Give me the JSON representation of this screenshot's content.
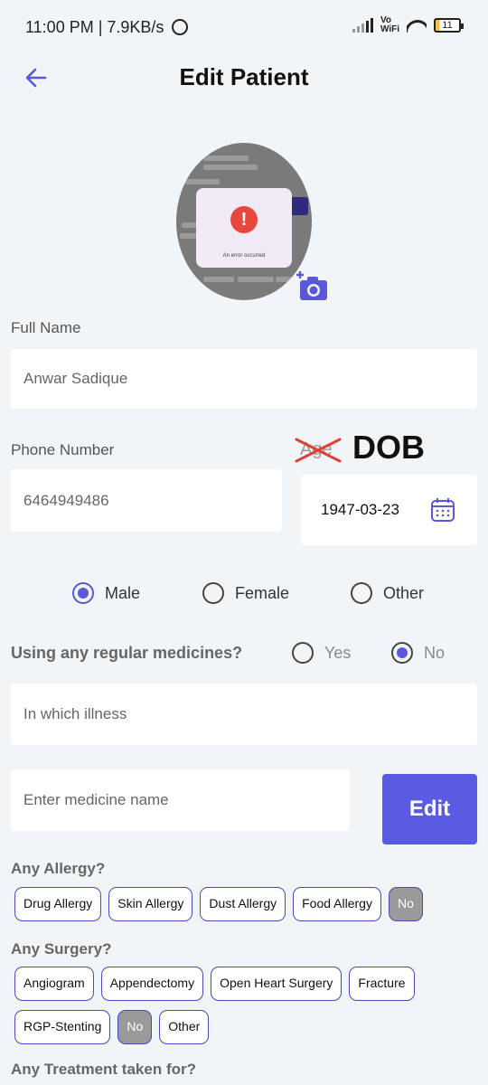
{
  "status": {
    "time": "11:00 PM | 7.9KB/s",
    "vowifi": "Vo\nWiFi",
    "battery": "11"
  },
  "header": {
    "title": "Edit Patient"
  },
  "avatar": {
    "error_text": "An error occurred"
  },
  "full_name": {
    "label": "Full Name",
    "value": "Anwar Sadique"
  },
  "phone": {
    "label": "Phone Number",
    "value": "6464949486"
  },
  "dob": {
    "struck_label": "Age",
    "label": "DOB",
    "value": "1947-03-23"
  },
  "gender": {
    "options": [
      "Male",
      "Female",
      "Other"
    ],
    "selected": "Male"
  },
  "medicines": {
    "question": "Using any regular medicines?",
    "options": [
      "Yes",
      "No"
    ],
    "selected": "No",
    "illness_placeholder": "In which illness",
    "medicine_placeholder": "Enter medicine name",
    "edit_label": "Edit"
  },
  "allergy": {
    "label": "Any Allergy?",
    "chips": [
      "Drug Allergy",
      "Skin Allergy",
      "Dust Allergy",
      "Food Allergy",
      "No"
    ],
    "selected": "No"
  },
  "surgery": {
    "label": "Any Surgery?",
    "chips": [
      "Angiogram",
      "Appendectomy",
      "Open Heart Surgery",
      "Fracture",
      "RGP-Stenting",
      "No",
      "Other"
    ],
    "selected": "No"
  },
  "treatment": {
    "label": "Any Treatment taken for?"
  },
  "colors": {
    "accent": "#5a58d8",
    "button": "#5a5ae2",
    "selected_chip": "#9a9a9a"
  }
}
